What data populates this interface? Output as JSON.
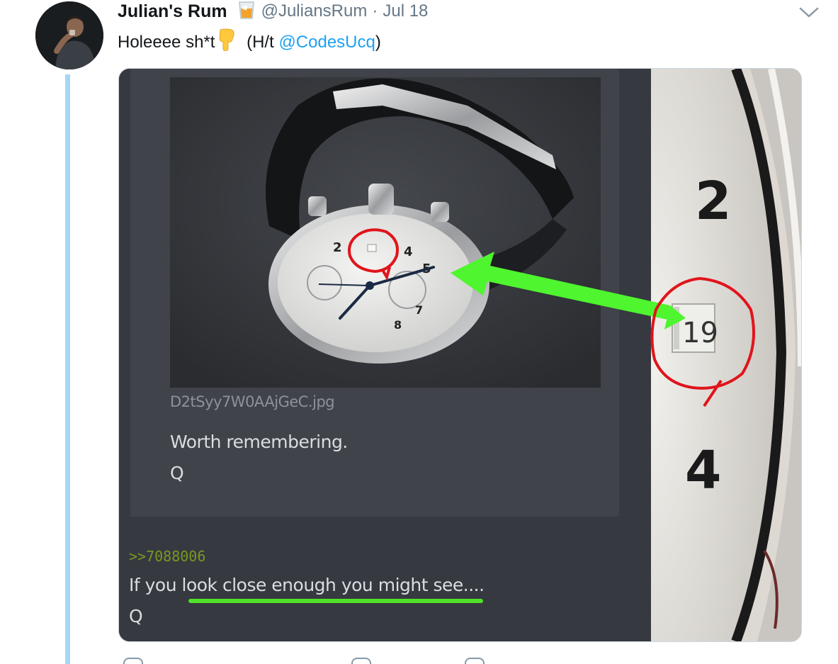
{
  "tweet": {
    "author_name": "Julian's Rum",
    "author_emoji": "tumbler-glass-emoji",
    "handle": "@JuliansRum",
    "separator": "·",
    "date": "Jul 18",
    "text_before": "Holeeee sh*t",
    "text_emoji": "pointing-down-emoji",
    "text_mid": " (H/t ",
    "mention": "@CodesUcq",
    "text_after": ")"
  },
  "media": {
    "post": {
      "filename": "D2tSyy7W0AAjGeC.jpg",
      "body": [
        "Worth remembering.",
        "Q"
      ]
    },
    "reply": {
      "link": ">>7088006",
      "lines": [
        "If you look close enough you might see....",
        "Q"
      ]
    },
    "closeup": {
      "numerals": [
        "2",
        "19",
        "4"
      ]
    },
    "annotation_colors": {
      "circle": "#e0141b",
      "arrow": "#4ff52f",
      "underline": "#4fe22a"
    }
  },
  "colors": {
    "link": "#1da1f2",
    "thread_line": "#a5d6f5",
    "secondary_text": "#657786",
    "board_background": "#363940",
    "greentext": "#789922"
  }
}
